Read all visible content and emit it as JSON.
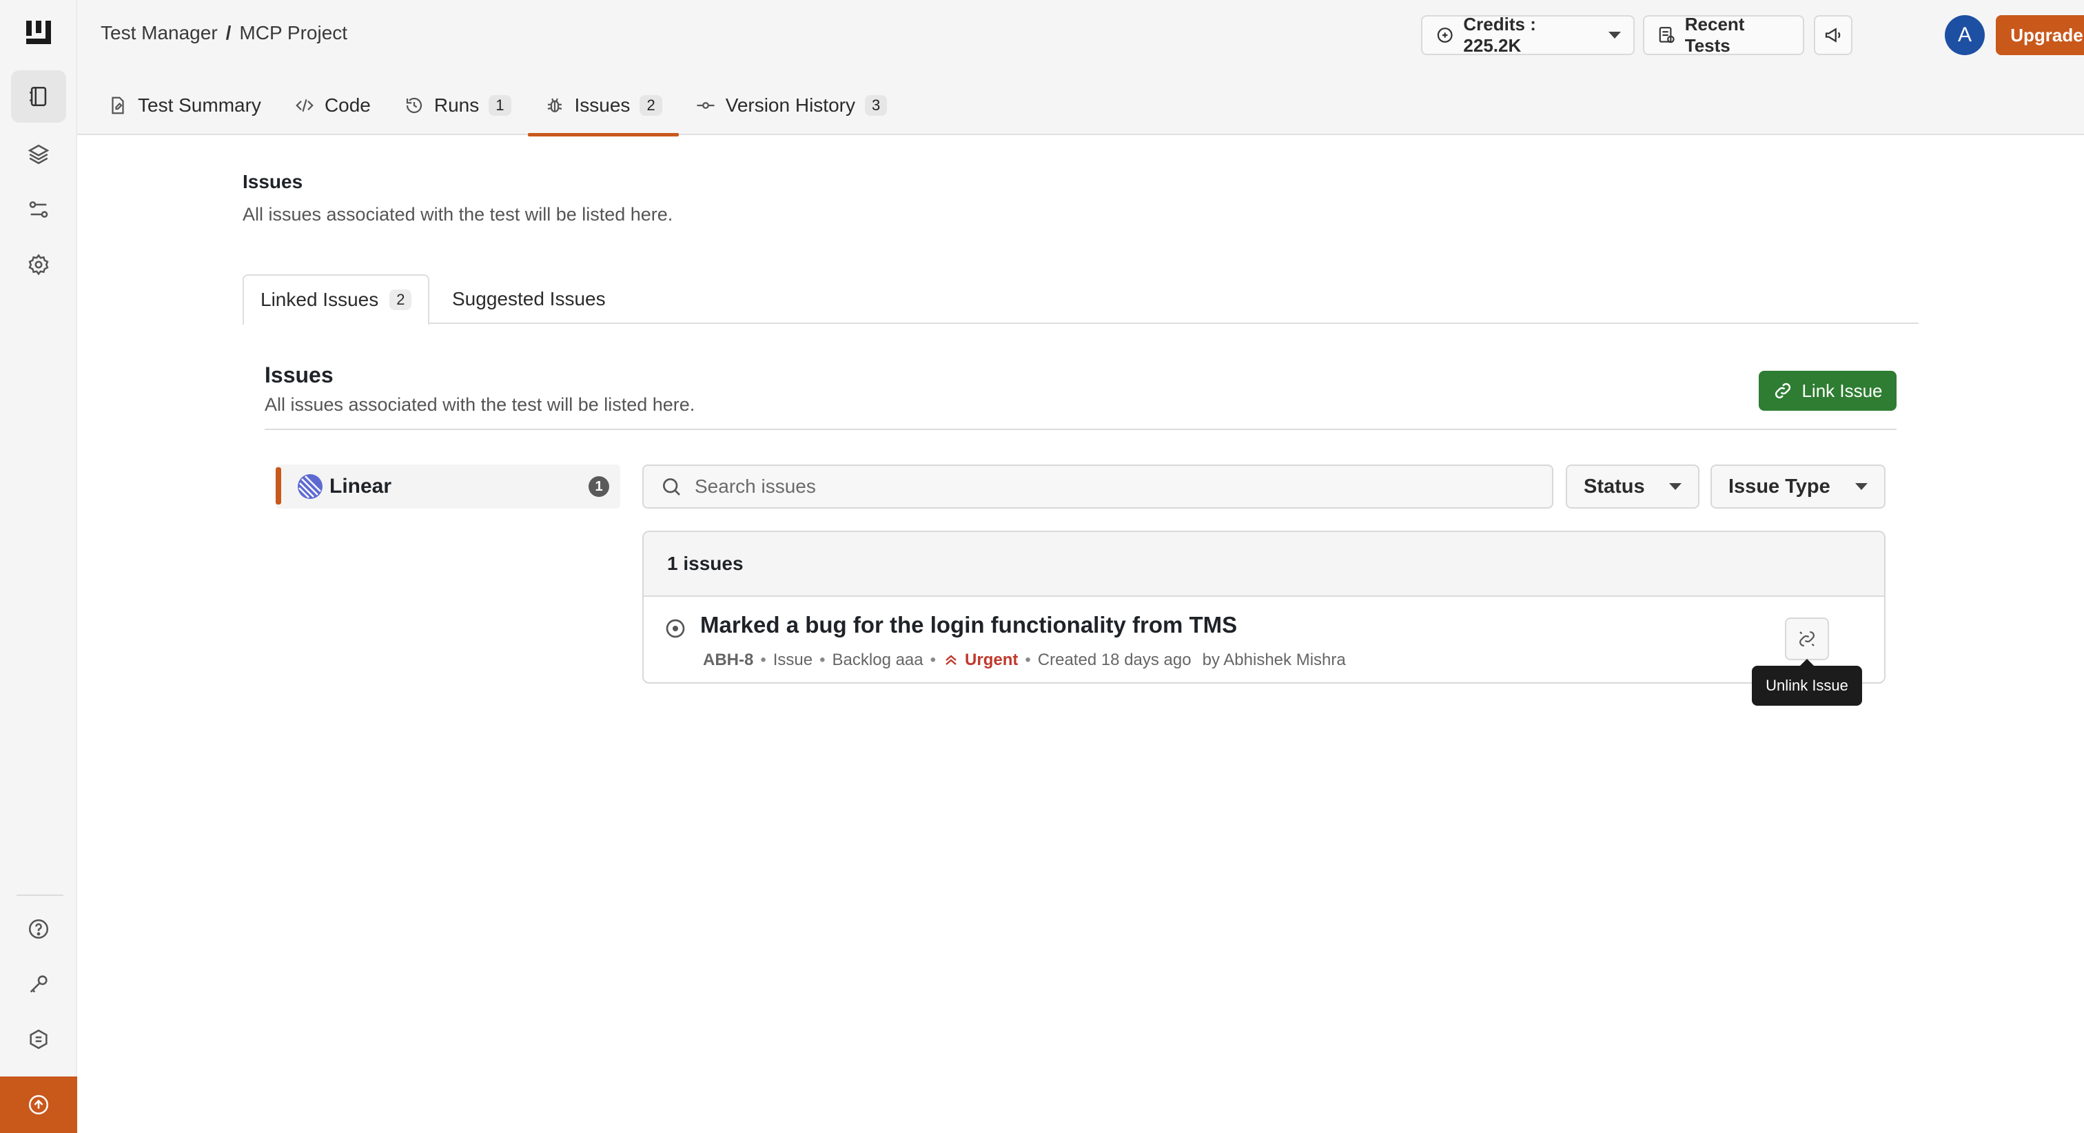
{
  "breadcrumb": {
    "root": "Test Manager",
    "separator": "/",
    "project": "MCP Project"
  },
  "header": {
    "credits_label": "Credits : 225.2K",
    "recent_tests_label": "Recent Tests",
    "avatar_initial": "A",
    "upgrade_label": "Upgrade Now"
  },
  "tabs": [
    {
      "label": "Test Summary",
      "icon": "file-edit-icon"
    },
    {
      "label": "Code",
      "icon": "code-icon"
    },
    {
      "label": "Runs",
      "icon": "history-icon",
      "count": "1"
    },
    {
      "label": "Issues",
      "icon": "bug-icon",
      "count": "2",
      "active": true
    },
    {
      "label": "Version History",
      "icon": "commit-icon",
      "count": "3"
    }
  ],
  "section": {
    "title": "Issues",
    "description": "All issues associated with the test will be listed here."
  },
  "subtabs": {
    "linked_label": "Linked Issues",
    "linked_count": "2",
    "suggested_label": "Suggested Issues"
  },
  "panel": {
    "title": "Issues",
    "description": "All issues associated with the test will be listed here.",
    "link_button_label": "Link Issue"
  },
  "provider": {
    "name": "Linear",
    "count": "1"
  },
  "search": {
    "placeholder": "Search issues",
    "value": ""
  },
  "filters": {
    "status_label": "Status",
    "type_label": "Issue Type"
  },
  "issues": {
    "count_label": "1 issues",
    "items": [
      {
        "title": "Marked a bug for the login functionality from TMS",
        "id": "ABH-8",
        "type": "Issue",
        "state": "Backlog aaa",
        "priority": "Urgent",
        "created": "Created 18 days ago",
        "author": "by Abhishek Mishra"
      }
    ]
  },
  "tooltip": {
    "unlink_label": "Unlink Issue"
  },
  "colors": {
    "accent": "#c9581b",
    "link_green": "#2e7d32",
    "urgent": "#c0392b",
    "avatar": "#1d4fa3"
  }
}
